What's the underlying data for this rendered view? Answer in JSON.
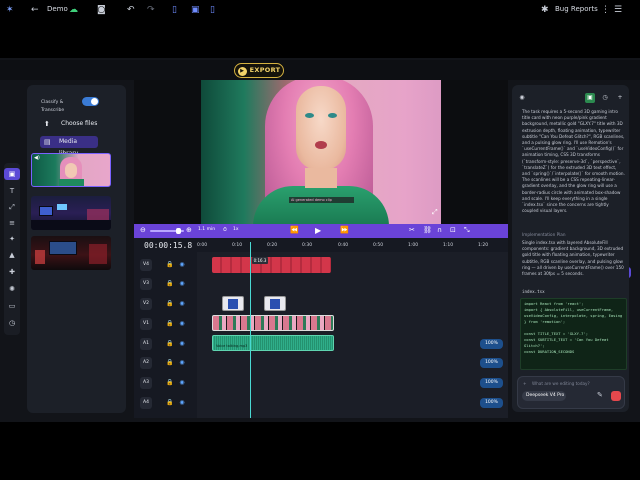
{
  "header": {
    "project_name": "Demo",
    "export_label": "EXPORT",
    "bug_reports": "Bug Reports"
  },
  "media_panel": {
    "toggle_label": "Classify & Transcribe",
    "choose_files": "Choose files",
    "media_library": "Media library",
    "thumbnails": [
      "portrait-woman",
      "gaming-room",
      "gaming-room-2"
    ]
  },
  "preview": {
    "caption_overlay": "AI generated demo clip",
    "zoom_label": "1.1 min",
    "speed_label": "1x"
  },
  "timeline": {
    "timecode": "00:00:15.8",
    "ruler": [
      "0:00",
      "0:10",
      "0:20",
      "0:30",
      "0:40",
      "0:50",
      "1:00",
      "1:10",
      "1:20"
    ],
    "playhead_label": "0:16.3",
    "video_tracks": [
      "V4",
      "V3",
      "V2",
      "V1"
    ],
    "audio_tracks": [
      "A1",
      "A2",
      "A3",
      "A4"
    ],
    "audio_levels": [
      "100%",
      "100%",
      "100%",
      "100%"
    ],
    "audio_clip_label": "Voice talking.mp3"
  },
  "chat": {
    "message_1": "The task requires a 5-second 3D gaming intro title card with neon purple/pink gradient background, metallic gold \"GLXY.7\" title with 3D extrusion depth, floating animation, typewriter subtitle \"Can You Defeat Glitch?\", RGB scanlines, and a pulsing glow ring. I'll use Remotion's `useCurrentFrame()` and `useVideoConfig()` for animation timing, CSS 3D transforms (`transform-style: preserve-3d`, `perspective`, `translateZ`) for the extruded 3D text effect, and `spring()`/`interpolate()` for smooth motion. The scanlines will be a CSS repeating-linear-gradient overlay, and the glow ring will use a border-radius circle with animated box-shadow and scale. I'll keep everything in a single `index.tsx` since the concerns are tightly coupled visual layers.",
    "section_label": "Implementation Plan",
    "message_2": "Single index.tsx with layered AbsoluteFill components: gradient background, 3D extruded gold title with floating animation, typewriter subtitle, RGB scanline overlay, and pulsing glow ring — all driven by useCurrentFrame() over 150 frames at 30fps = 5 seconds.",
    "file_label": "index.tsx",
    "code": "import React from 'react';\nimport { AbsoluteFill, useCurrentFrame,\nuseVideoConfig, interpolate, spring, Easing\n} from 'remotion';\n\nconst TITLE_TEXT = 'GLXY.7';\nconst SUBTITLE_TEXT = 'Can You Defeat\nGlitch?';\nconst DURATION_SECONDS",
    "input_placeholder": "What are we editing today?",
    "model_label": "Deepseek V4 Pro"
  },
  "colors": {
    "accent_purple": "#6a43d8",
    "export_gold": "#f3d36a",
    "playhead_teal": "#4ad9d3",
    "audio_clip": "#2fae8a",
    "text_clip": "#d3364a",
    "send_red": "#e5484d"
  }
}
